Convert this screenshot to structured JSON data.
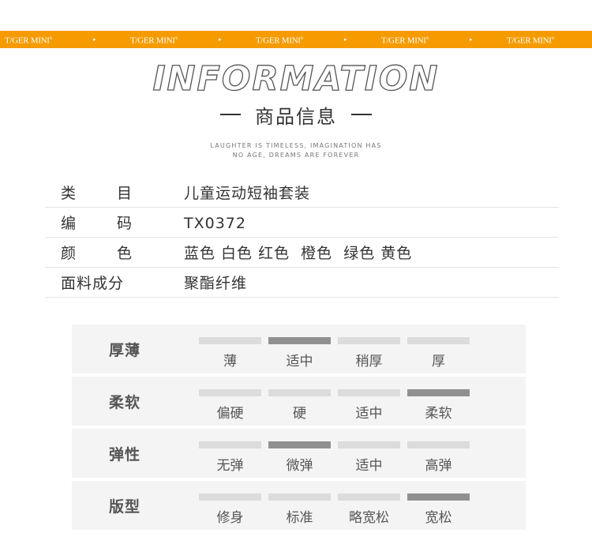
{
  "banner": {
    "brand": "T/GER MINI",
    "brand_mark": "®",
    "arrow": "▸",
    "color": "#f59b00"
  },
  "header": {
    "title": "INFORMATION",
    "subtitle": "商品信息",
    "tagline_line1": "LAUGHTER IS TIMELESS, IMAGINATION HAS",
    "tagline_line2": "NO AGE, DREAMS ARE FOREVER"
  },
  "specs": [
    {
      "label": "类目",
      "value": "儿童运动短袖套装"
    },
    {
      "label": "编码",
      "value": "TX0372"
    },
    {
      "label": "颜色",
      "value": "蓝色 白色 红色  橙色  绿色 黄色"
    },
    {
      "label": "面料成分",
      "value": "聚酯纤维"
    }
  ],
  "attributes": [
    {
      "name": "厚薄",
      "options": [
        "薄",
        "适中",
        "稍厚",
        "厚"
      ],
      "selected_index": 1
    },
    {
      "name": "柔软",
      "options": [
        "偏硬",
        "硬",
        "适中",
        "柔软"
      ],
      "selected_index": 3
    },
    {
      "name": "弹性",
      "options": [
        "无弹",
        "微弹",
        "适中",
        "高弹"
      ],
      "selected_index": 1
    },
    {
      "name": "版型",
      "options": [
        "修身",
        "标准",
        "略宽松",
        "宽松"
      ],
      "selected_index": 3
    }
  ],
  "colors": {
    "bar_inactive": "#dcdcdc",
    "bar_active": "#909090",
    "block_bg": "#f4f4f4"
  }
}
